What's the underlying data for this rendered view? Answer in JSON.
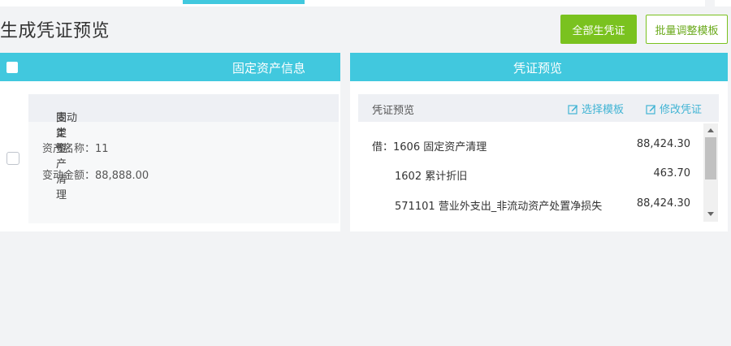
{
  "page": {
    "title": "生成凭证预览",
    "buttons": {
      "generate_all": "全部生凭证",
      "batch_adjust": "批量调整模板"
    }
  },
  "asset_panel": {
    "header": "固定资产信息",
    "card": {
      "change_type_label": "变动类型：",
      "change_type_value": "固定资产清理",
      "asset_name_label": "资产名称：",
      "asset_name_value": "11",
      "change_amount_label": "变动金额：",
      "change_amount_value": "88,888.00"
    }
  },
  "voucher_panel": {
    "header": "凭证预览",
    "card": {
      "title": "凭证预览",
      "select_template": "选择模板",
      "edit_voucher": "修改凭证",
      "entries": [
        {
          "prefix": "借：",
          "account": "1606 固定资产清理",
          "amount": "88,424.30"
        },
        {
          "prefix": "",
          "account": "1602 累计折旧",
          "amount": "463.70"
        },
        {
          "prefix": "",
          "account": "571101 营业外支出_非流动资产处置净损失",
          "amount": "88,424.30"
        }
      ]
    }
  },
  "colors": {
    "header_cyan": "#41c8de",
    "primary_green": "#7ac21f",
    "link_blue": "#41b4d4"
  },
  "icons": [
    "edit-icon",
    "scroll-up-arrow-icon",
    "scroll-down-arrow-icon"
  ]
}
